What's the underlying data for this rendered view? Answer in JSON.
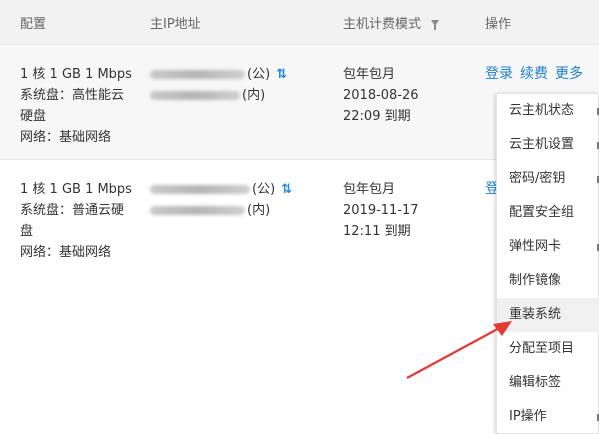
{
  "header": {
    "config": "配置",
    "ip": "主IP地址",
    "billing": "主机计费模式",
    "ops": "操作"
  },
  "rows": [
    {
      "config": [
        "1 核 1 GB 1 Mbps",
        "系统盘：高性能云",
        "硬盘",
        "网络：基础网络"
      ],
      "ip_public_suffix": "(公)",
      "ip_private_suffix": "(内)",
      "billing": [
        "包年包月",
        "2018-08-26",
        "22:09 到期"
      ],
      "ops": [
        "登录",
        "续费",
        "更多"
      ]
    },
    {
      "config": [
        "1 核 1 GB 1 Mbps",
        "系统盘：普通云硬",
        "盘",
        "网络：基础网络"
      ],
      "ip_public_suffix": "(公)",
      "ip_private_suffix": "(内)",
      "billing": [
        "包年包月",
        "2019-11-17",
        "12:11 到期"
      ],
      "ops": [
        "登"
      ]
    }
  ],
  "dropdown": {
    "items": [
      {
        "label": "云主机状态",
        "submenu": true
      },
      {
        "label": "云主机设置",
        "submenu": true
      },
      {
        "label": "密码/密钥",
        "submenu": true
      },
      {
        "label": "配置安全组",
        "submenu": false
      },
      {
        "label": "弹性网卡",
        "submenu": true
      },
      {
        "label": "制作镜像",
        "submenu": false
      },
      {
        "label": "重装系统",
        "submenu": false,
        "active": true
      },
      {
        "label": "分配至项目",
        "submenu": false
      },
      {
        "label": "编辑标签",
        "submenu": false
      },
      {
        "label": "IP操作",
        "submenu": true
      }
    ]
  },
  "colors": {
    "link": "#1e7fd6",
    "annotation_arrow": "#e53935",
    "swap_icon": "#1e88e5"
  },
  "icons": {
    "filter": "filter-icon",
    "swap": "swap-icon"
  }
}
